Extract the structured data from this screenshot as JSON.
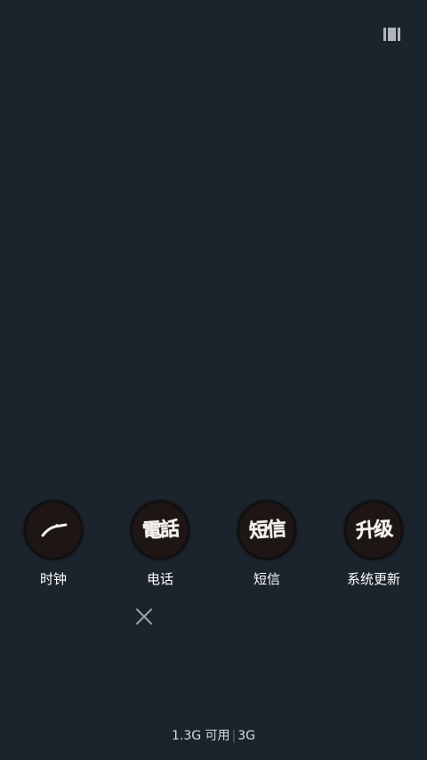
{
  "apps": [
    {
      "id": "clock",
      "label": "时钟",
      "icon": "clock-hand-icon"
    },
    {
      "id": "phone",
      "label": "电话",
      "glyph": "電話",
      "icon": "calligraphy-phone-icon"
    },
    {
      "id": "sms",
      "label": "短信",
      "glyph": "短信",
      "icon": "calligraphy-sms-icon"
    },
    {
      "id": "update",
      "label": "系统更新",
      "glyph": "升级",
      "icon": "calligraphy-update-icon"
    }
  ],
  "footer": {
    "memory": "1.3G 可用",
    "network": "3G"
  }
}
